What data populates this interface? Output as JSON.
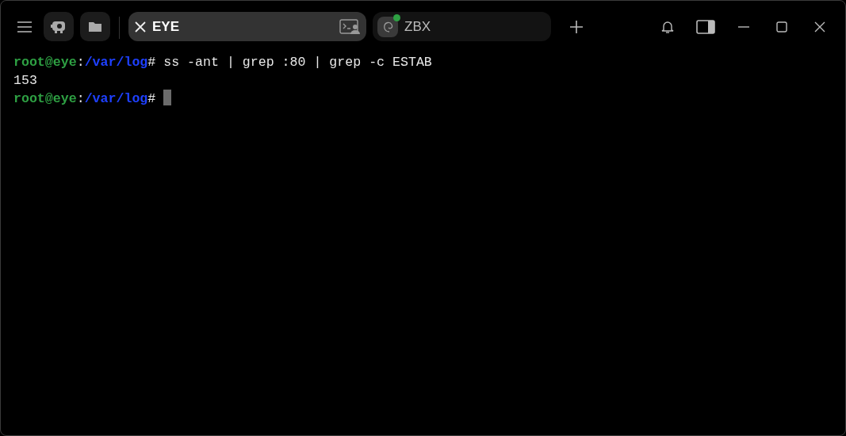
{
  "tabs": [
    {
      "label": "EYE",
      "selected": true
    },
    {
      "label": "ZBX",
      "selected": false,
      "online": true
    }
  ],
  "terminal": {
    "lines": [
      {
        "kind": "prompt",
        "user": "root@eye",
        "separator": ":",
        "path": "/var/log",
        "symbol": "#",
        "command": "ss -ant | grep :80 | grep -c ESTAB"
      },
      {
        "kind": "output",
        "text": "153"
      },
      {
        "kind": "prompt",
        "user": "root@eye",
        "separator": ":",
        "path": "/var/log",
        "symbol": "#",
        "cursor": true
      }
    ]
  }
}
